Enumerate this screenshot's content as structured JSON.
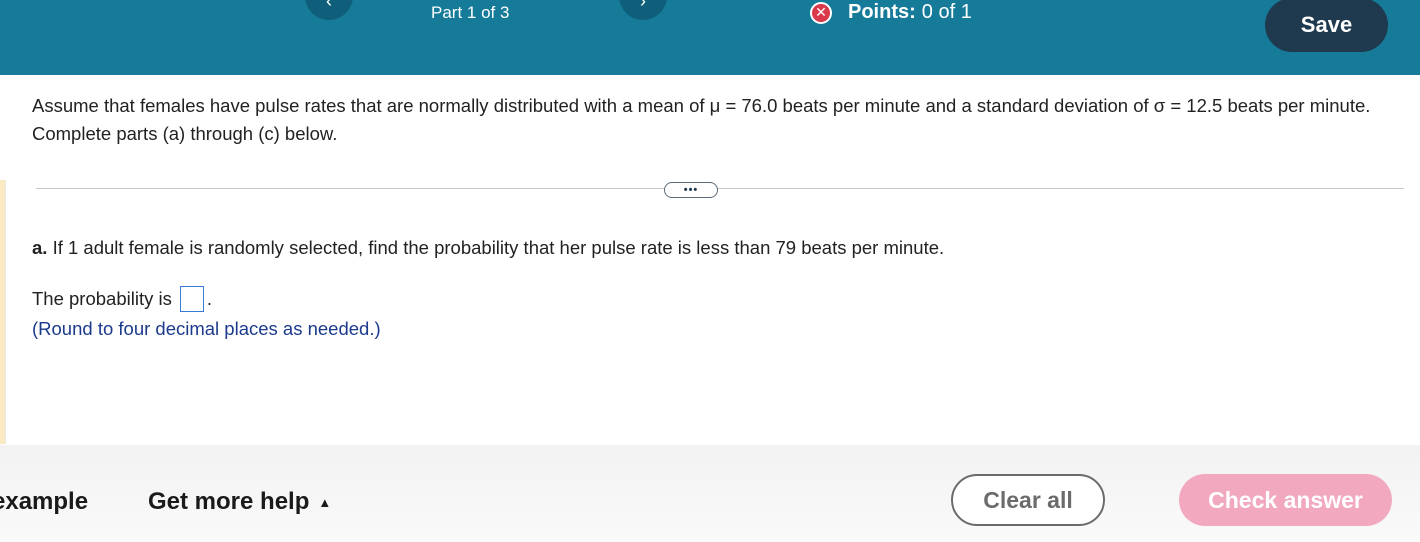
{
  "header": {
    "part_label": "Part 1 of 3",
    "points_label": "Points:",
    "points_value": "0 of 1",
    "save_label": "Save",
    "prev_icon": "chevron-left-icon",
    "next_icon": "chevron-right-icon",
    "status_icon": "x-circle-icon"
  },
  "question": {
    "intro": "Assume that females have pulse rates that are normally distributed with a mean of μ = 76.0 beats per minute and a standard deviation of σ = 12.5 beats per minute. Complete parts (a) through (c) below.",
    "more_label": "•••",
    "part_a_prefix": "a.",
    "part_a_text": " If 1 adult female is randomly selected, find the probability that her pulse rate is less than 79 beats per minute.",
    "answer_prefix": "The probability is",
    "answer_value": "",
    "answer_suffix": ".",
    "round_note": "(Round to four decimal places as needed.)"
  },
  "footer": {
    "example_label": "example",
    "more_help_label": "Get more help",
    "clear_label": "Clear all",
    "check_label": "Check answer"
  },
  "colors": {
    "header_bg": "#167a99",
    "save_bg": "#1f3a4e",
    "check_bg": "#f2a9c0",
    "incorrect": "#d9394b"
  }
}
